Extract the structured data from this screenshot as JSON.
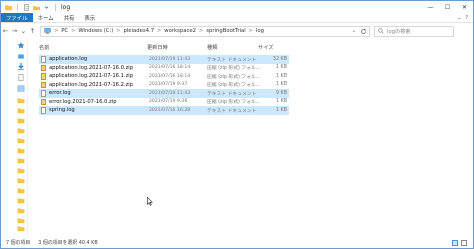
{
  "window": {
    "title": "log",
    "controls": {
      "minimize": "—",
      "maximize": "☐",
      "close": "✕"
    }
  },
  "ribbon": {
    "tabs": [
      "ファイル",
      "ホーム",
      "共有",
      "表示"
    ],
    "right_chevron": "⌄",
    "help": "?"
  },
  "nav": {
    "back": "←",
    "forward": "→",
    "recent": "⌄",
    "up": "↑"
  },
  "address": {
    "crumbs": [
      "PC",
      "Windows (C:)",
      "pleiades4.7",
      "workspace2",
      "springBootTrial",
      "log"
    ],
    "separator": ">"
  },
  "search": {
    "placeholder": "logの検索"
  },
  "columns": {
    "name": "名前",
    "date": "更新日時",
    "type": "種類",
    "size": "サイズ"
  },
  "files": [
    {
      "name": "application.log",
      "date": "2021/07/19 11:43",
      "type": "テキスト ドキュメント",
      "size": "32 KB",
      "kind": "text",
      "selected": true
    },
    {
      "name": "application.log.2021-07-16.0.zip",
      "date": "2021/07/16 18:14",
      "type": "圧縮 (zip 形式) フォル...",
      "size": "1 KB",
      "kind": "zip",
      "selected": false
    },
    {
      "name": "application.log.2021-07-16.1.zip",
      "date": "2021/07/16 18:14",
      "type": "圧縮 (zip 形式) フォル...",
      "size": "1 KB",
      "kind": "zip",
      "selected": false
    },
    {
      "name": "application.log.2021-07-16.2.zip",
      "date": "2021/07/19 9:37",
      "type": "圧縮 (zip 形式) フォル...",
      "size": "1 KB",
      "kind": "zip",
      "selected": false
    },
    {
      "name": "error.log",
      "date": "2021/07/19 11:43",
      "type": "テキスト ドキュメント",
      "size": "9 KB",
      "kind": "text",
      "selected": true
    },
    {
      "name": "error.log.2021-07-16.0.zip",
      "date": "2021/07/19 9:36",
      "type": "圧縮 (zip 形式) フォル...",
      "size": "1 KB",
      "kind": "zip",
      "selected": false
    },
    {
      "name": "spring.log",
      "date": "2021/07/16 16:28",
      "type": "テキスト ドキュメント",
      "size": "1 KB",
      "kind": "text",
      "selected": true
    }
  ],
  "status": {
    "count": "7 個の項目",
    "selection": "3 個の項目を選択 40.4 KB"
  },
  "colors": {
    "accent": "#1979ca",
    "selection": "#cce8ff",
    "folder": "#f4c542"
  }
}
